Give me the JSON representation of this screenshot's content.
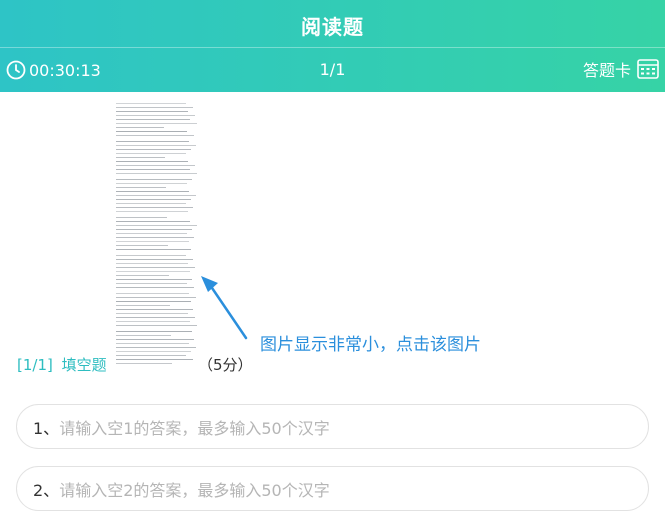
{
  "header": {
    "title": "阅读题",
    "timer": "00:30:13",
    "progress": "1/1",
    "answer_card_label": "答题卡"
  },
  "annotation": "图片显示非常小，点击该图片",
  "question": {
    "index": "[1/1]",
    "type": "填空题",
    "score": "（5分）"
  },
  "blanks": [
    {
      "number": "1、",
      "placeholder": "请输入空1的答案，最多输入50个汉字"
    },
    {
      "number": "2、",
      "placeholder": "请输入空2的答案，最多输入50个汉字"
    }
  ],
  "colors": {
    "header_gradient_start": "#2ec4c6",
    "header_gradient_end": "#36d3a6",
    "accent": "#2ebdc0",
    "annotation": "#2b8fdc"
  }
}
